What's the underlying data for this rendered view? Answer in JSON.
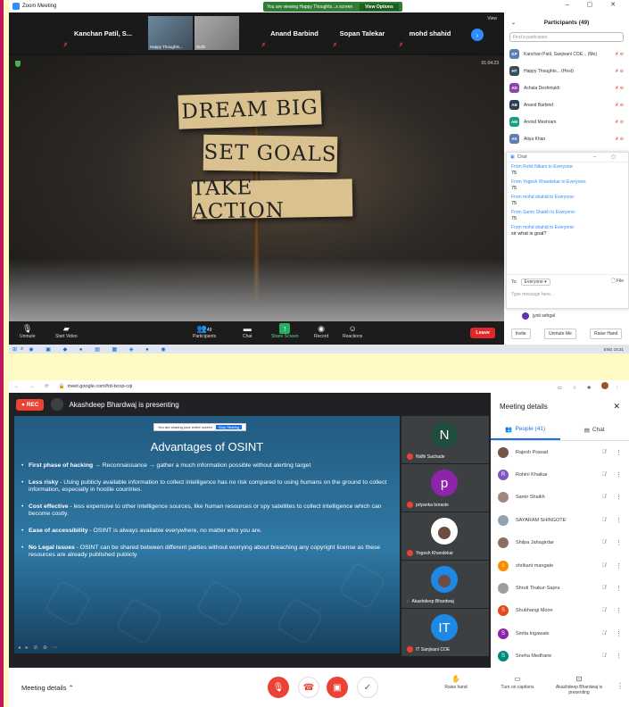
{
  "zoom": {
    "title": "Zoom Meeting",
    "banner": "You are viewing Happy Thoughts...s screen",
    "view_options": "View Options",
    "view_label": "View",
    "strip": [
      "Kanchan Patil, S...",
      "Anand Barbind",
      "Sopan Talekar",
      "mohd shahid"
    ],
    "video_tiles": [
      {
        "label": "Happy Thoughts..."
      },
      {
        "label": "Nidhi"
      }
    ],
    "clock": "01:04:23",
    "board": [
      "DREAM BIG",
      "SET GOALS",
      "TAKE ACTION"
    ],
    "toolbar": {
      "unmute": "Unmute",
      "start_video": "Start Video",
      "participants": "Participants",
      "participants_count": "49",
      "chat": "Chat",
      "share": "Share Screen",
      "record": "Record",
      "reactions": "Reactions",
      "leave": "Leave"
    },
    "participants_panel": {
      "header": "Participants (49)",
      "find_placeholder": "Find a participant",
      "rows": [
        {
          "initials": "KP",
          "name": "Kanchan Patil, Sanjivani COE... (Me)",
          "color": "#5b7fb0"
        },
        {
          "initials": "HT",
          "name": "Happy Thoughts... (Host)",
          "color": "#3d4c5a"
        },
        {
          "initials": "AD",
          "name": "Achala Deshmukh",
          "color": "#8e44ad"
        },
        {
          "initials": "AB",
          "name": "Anand Barbind",
          "color": "#2c3e50"
        },
        {
          "initials": "AM",
          "name": "Arvind Meshram",
          "color": "#16a085"
        },
        {
          "initials": "AK",
          "name": "Atiya Khan",
          "color": "#5b7fb0"
        }
      ],
      "bottom_name": "jyoti sehgal",
      "invite": "Invite",
      "unmute_me": "Unmute Me",
      "raise_hand": "Raise Hand"
    },
    "chat": {
      "header": "Chat",
      "messages": [
        {
          "from": "From Rohit Nikam to Everyone:",
          "text": "75"
        },
        {
          "from": "From Yogesh Khandekar to Everyone:",
          "text": "75"
        },
        {
          "from": "From mohd shahid to Everyone:",
          "text": "75"
        },
        {
          "from": "From Samir Shaikh to Everyone:",
          "text": "75"
        },
        {
          "from": "From mohd shahid to Everyone:",
          "text": "sir what is goal?"
        }
      ],
      "to_label": "To:",
      "to_value": "Everyone",
      "file": "File",
      "placeholder": "Type message here..."
    },
    "taskbar_tray": "ENG 15:31"
  },
  "meet": {
    "url": "meet.google.com/frd-bcnp-cqi",
    "rec": "REC",
    "presenting": "Akashdeep Bhardwaj is presenting",
    "sharing_banner": "You are sharing your entire screen",
    "stop_sharing": "Stop Sharing",
    "slide_title": "Advantages of OSINT",
    "bullets": [
      {
        "head": "First phase of hacking",
        "text": " → Reconnaissance → gather a much information possible without alerting target"
      },
      {
        "head": "Less risky",
        "text": " - Using publicly available information to collect intelligence has no risk compared to using humans on the ground to collect information, especially in hostile countries."
      },
      {
        "head": "Cost effective",
        "text": " - less expensive to other intelligence sources, like human resources or spy satellites to collect intelligence which can become costly."
      },
      {
        "head": "Ease of accessibility",
        "text": " - OSINT is always available everywhere, no matter who you are."
      },
      {
        "head": "No Legal issues",
        "text": " - OSINT can be shared between different parties without worrying about breaching any copyright license as these resources are already published publicly."
      }
    ],
    "tiles": [
      {
        "letter": "N",
        "name": "Nidhi Sachade",
        "color": "#1f4e3d"
      },
      {
        "letter": "p",
        "name": "priyanka boraste",
        "color": "#8e24aa"
      },
      {
        "letter": "",
        "name": "Yogesh Khandekar",
        "color": "#ffffff"
      },
      {
        "letter": "",
        "name": "Akashdeep Bhardwaj",
        "color": "#1e88e5"
      },
      {
        "letter": "IT",
        "name": "IT Sanjivani COE",
        "color": "#1e88e5"
      }
    ],
    "panel": {
      "title": "Meeting details",
      "people_tab": "People (41)",
      "chat_tab": "Chat",
      "people": [
        {
          "name": "Rajesh Prasad",
          "initial": "",
          "color": "#795548"
        },
        {
          "name": "Rohini Khaikar",
          "initial": "R",
          "color": "#7e57c2"
        },
        {
          "name": "Samir Shaikh",
          "initial": "",
          "color": "#a1887f"
        },
        {
          "name": "SAYARAM SHINGOTE",
          "initial": "",
          "color": "#90a4ae"
        },
        {
          "name": "Shilpa Jahagirdar",
          "initial": "",
          "color": "#8d6e63"
        },
        {
          "name": "shrikant mangate",
          "initial": "s",
          "color": "#fb8c00"
        },
        {
          "name": "Shruti Thakur-Sapra",
          "initial": "",
          "color": "#9e9e9e"
        },
        {
          "name": "Shubhangi Moon",
          "initial": "S",
          "color": "#e64a19"
        },
        {
          "name": "Smita Ingawale",
          "initial": "S",
          "color": "#8e24aa"
        },
        {
          "name": "Sneha Medhane",
          "initial": "S",
          "color": "#00897b"
        }
      ]
    },
    "bottom": {
      "details": "Meeting details",
      "raise_hand": "Raise hand",
      "captions": "Turn on captions",
      "presenting": "Akashdeep Bhardwaj is presenting"
    }
  }
}
